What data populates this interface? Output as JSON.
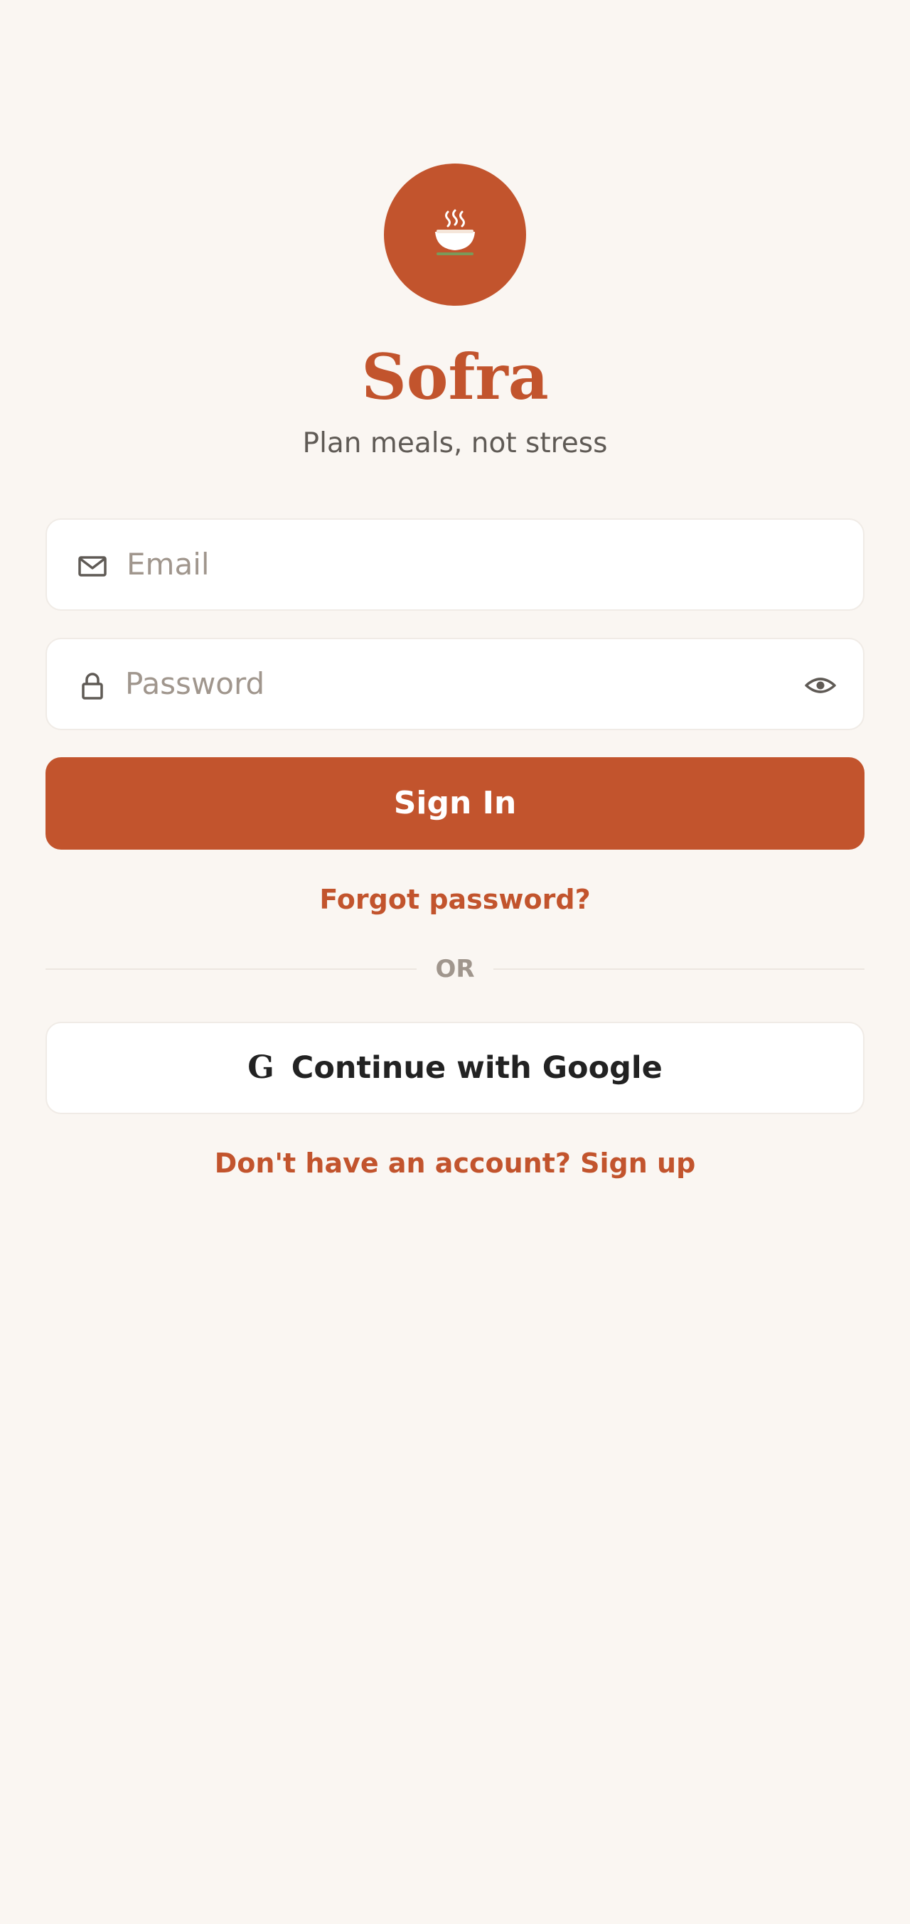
{
  "app": {
    "title": "Sofra",
    "tagline": "Plan meals, not stress",
    "logo_icon": "steaming-bowl-icon"
  },
  "form": {
    "email_placeholder": "Email",
    "email_icon": "mail-icon",
    "password_placeholder": "Password",
    "password_icon": "lock-icon",
    "show_password_icon": "eye-icon",
    "sign_in_label": "Sign In",
    "forgot_label": "Forgot password?",
    "divider_label": "OR",
    "google_glyph": "G",
    "google_label": "Continue with Google",
    "signup_label": "Don't have an account? Sign up"
  },
  "colors": {
    "accent": "#c2542d",
    "background": "#faf6f2",
    "placeholder": "#a0968d",
    "muted_text": "#5f5a55"
  }
}
